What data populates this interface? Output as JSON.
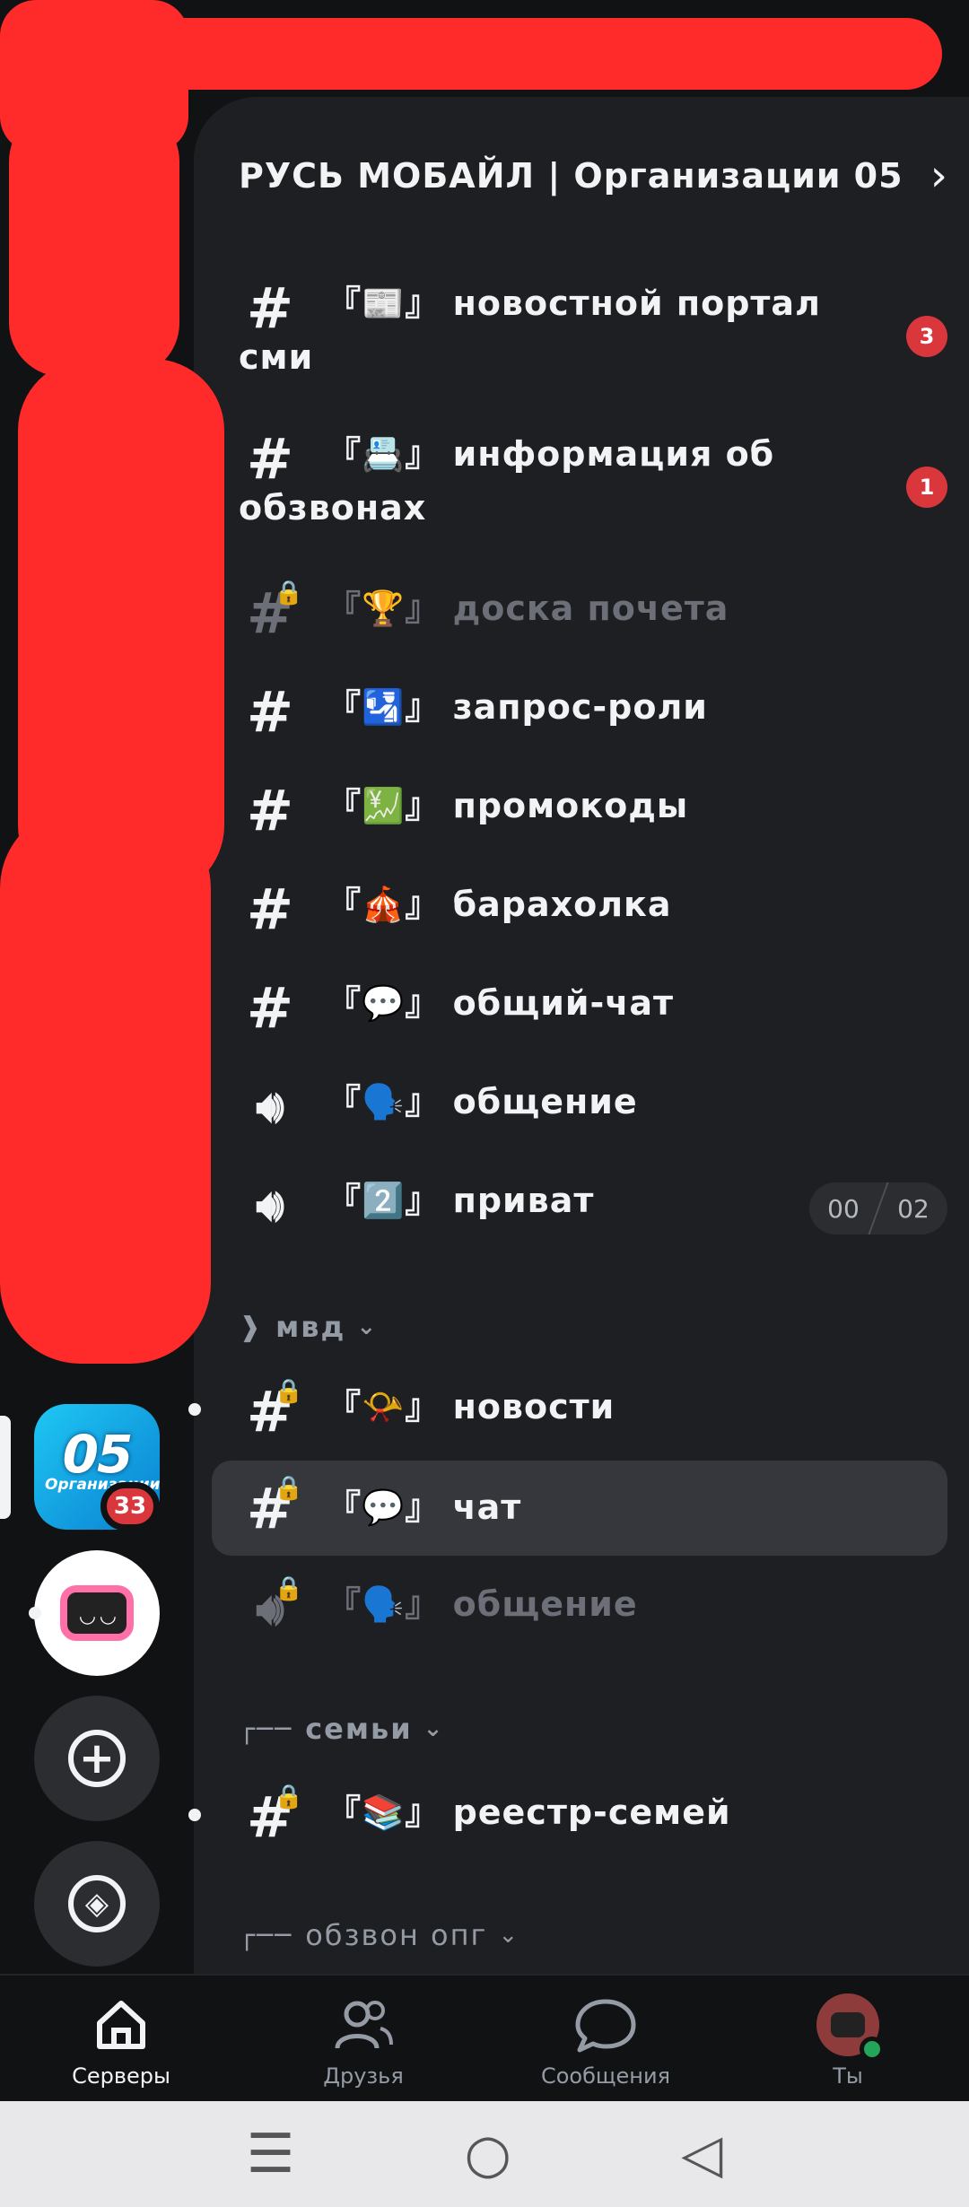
{
  "server": {
    "name": "РУСЬ МОБАЙЛ | Организации 05",
    "icon_text": "05",
    "icon_subtext": "Организации",
    "badge_count": "33"
  },
  "channels_top": [
    {
      "icon": "#",
      "emoji": "『📰』",
      "name": "новостной портал",
      "name_line2": "сми",
      "badge": "3"
    },
    {
      "icon": "#",
      "emoji": "『📇』",
      "name": "информация об",
      "name_line2": "обзвонах",
      "badge": "1"
    },
    {
      "icon": "#",
      "emoji": "『🏆』",
      "name": "доска почета",
      "locked": true,
      "muted": true
    },
    {
      "icon": "#",
      "emoji": "『🛂』",
      "name": "запрос-роли"
    },
    {
      "icon": "#",
      "emoji": "『💹』",
      "name": "промокоды"
    },
    {
      "icon": "#",
      "emoji": "『🎪』",
      "name": "барахолка"
    },
    {
      "icon": "#",
      "emoji": "『💬』",
      "name": "общий-чат"
    },
    {
      "icon": "voice",
      "emoji": "『🗣️』",
      "name": "общение"
    },
    {
      "icon": "voice",
      "emoji": "『2️⃣』",
      "name": "приват",
      "voice_users": "00",
      "voice_limit": "02"
    }
  ],
  "category_mvd": {
    "name": "мвд"
  },
  "channels_mvd": [
    {
      "emoji": "『📯』",
      "name": "новости"
    },
    {
      "emoji": "『💬』",
      "name": "чат"
    },
    {
      "emoji": "『🗣️』",
      "name": "общение"
    }
  ],
  "category_families": {
    "prefix": "┌──",
    "name": "семьи"
  },
  "channels_families": [
    {
      "emoji": "『📚』",
      "name": "реестр-семей"
    }
  ],
  "category_calls": {
    "prefix": "┌──",
    "name": "обзвон опг"
  },
  "bottom_nav": {
    "servers": "Серверы",
    "friends": "Друзья",
    "messages": "Сообщения",
    "you": "Ты"
  },
  "icons": {
    "hash": "hash-icon",
    "voice": "speaker-icon",
    "lock": "lock-icon"
  },
  "colors": {
    "background": "#111214",
    "panel": "#1e1f22",
    "badge": "#da373c",
    "online": "#23a55a",
    "redaction": "#ff2b2b"
  }
}
